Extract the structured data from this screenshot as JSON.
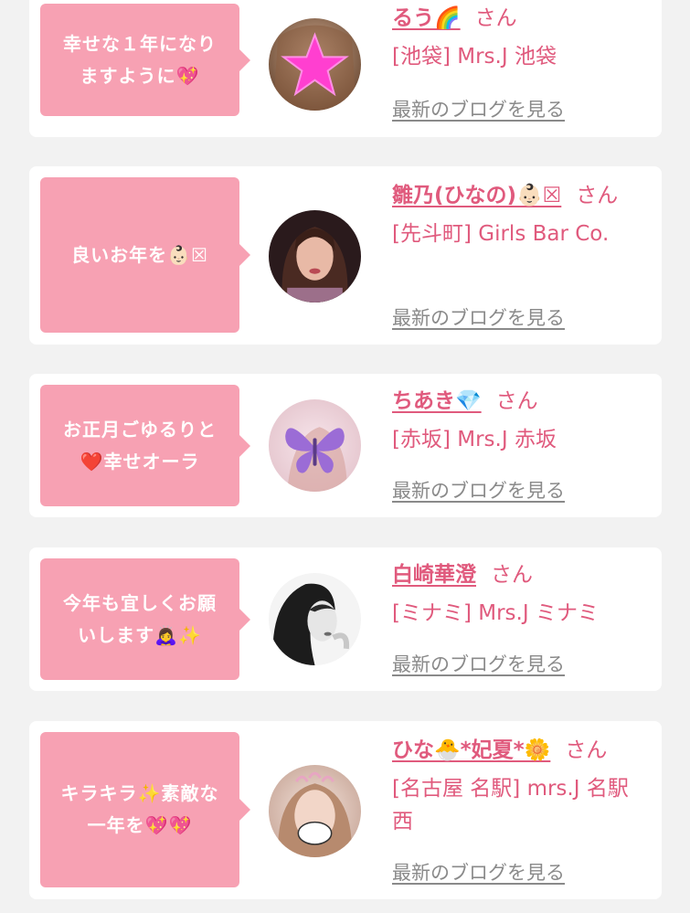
{
  "entries": [
    {
      "message": "幸せな１年になり\nますように💖",
      "name": "るう🌈",
      "honorific": "さん",
      "shop": "[池袋] Mrs.J 池袋",
      "blog_link": "最新のブログを見る",
      "avatar_icon": "star-sticker-photo"
    },
    {
      "message": "良いお年を👶🏻☒",
      "name": "雛乃(ひなの)👶🏻☒",
      "honorific": "さん",
      "shop": "[先斗町] Girls Bar Co.",
      "blog_link": "最新のブログを見る",
      "avatar_icon": "portrait-photo"
    },
    {
      "message": "お正月ごゆるりと\n❤️幸せオーラ",
      "name": "ちあき💎",
      "honorific": "さん",
      "shop": "[赤坂] Mrs.J 赤坂",
      "blog_link": "最新のブログを見る",
      "avatar_icon": "butterfly-sticker-photo"
    },
    {
      "message": "今年も宜しくお願\nいします🙇‍♀️✨",
      "name": "白崎華澄",
      "honorific": "さん",
      "shop": "[ミナミ] Mrs.J ミナミ",
      "blog_link": "最新のブログを見る",
      "avatar_icon": "monochrome-portrait-photo"
    },
    {
      "message": "キラキラ✨素敵な\n一年を💖💖",
      "name": "ひな🐣*妃夏*🌼",
      "honorific": "さん",
      "shop": "[名古屋 名駅] mrs.J 名駅西",
      "blog_link": "最新のブログを見る",
      "avatar_icon": "mask-portrait-photo"
    }
  ],
  "colors": {
    "accent": "#e05a7d",
    "bubble": "#f7a1b3",
    "background": "#f2f2f2",
    "link_gray": "#8a8a8a"
  }
}
